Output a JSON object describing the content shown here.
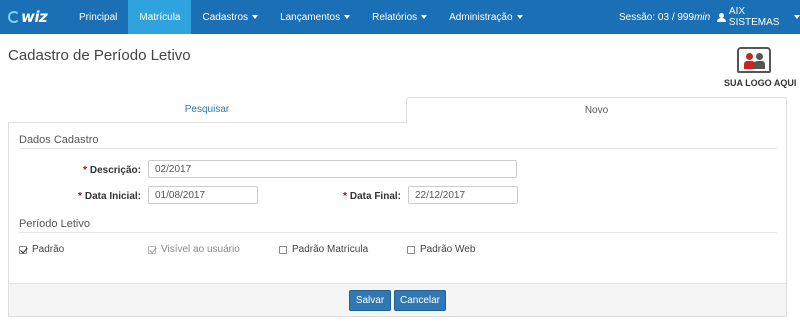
{
  "navbar": {
    "brand": "wiz",
    "items": [
      {
        "label": "Principal",
        "dropdown": false,
        "active": false
      },
      {
        "label": "Matrícula",
        "dropdown": false,
        "active": true
      },
      {
        "label": "Cadastros",
        "dropdown": true,
        "active": false
      },
      {
        "label": "Lançamentos",
        "dropdown": true,
        "active": false
      },
      {
        "label": "Relatórios",
        "dropdown": true,
        "active": false
      },
      {
        "label": "Administração",
        "dropdown": true,
        "active": false
      }
    ],
    "session_label": "Sessão: 03 / 999",
    "session_unit": "min",
    "user": "AIX SISTEMAS"
  },
  "page": {
    "title": "Cadastro de Período Letivo",
    "logo_caption": "SUA LOGO AQUI"
  },
  "tabs": {
    "pesquisar": "Pesquisar",
    "novo": "Novo"
  },
  "form": {
    "section_dados": "Dados Cadastro",
    "descricao_label": "Descrição:",
    "descricao_value": "02/2017",
    "data_inicial_label": "Data Inicial:",
    "data_inicial_value": "01/08/2017",
    "data_final_label": "Data Final:",
    "data_final_value": "22/12/2017",
    "section_periodo": "Período Letivo",
    "checkboxes": [
      {
        "label": "Padrão",
        "checked": true,
        "disabled": false
      },
      {
        "label": "Visível ao usuário",
        "checked": true,
        "disabled": true
      },
      {
        "label": "Padrão Matrícula",
        "checked": false,
        "disabled": false
      },
      {
        "label": "Padrão Web",
        "checked": false,
        "disabled": false
      }
    ]
  },
  "buttons": {
    "salvar": "Salvar",
    "cancelar": "Cancelar"
  },
  "colors": {
    "navbar": "#1a6fb5",
    "nav_active": "#2ea3dd",
    "button": "#2f78b5"
  }
}
